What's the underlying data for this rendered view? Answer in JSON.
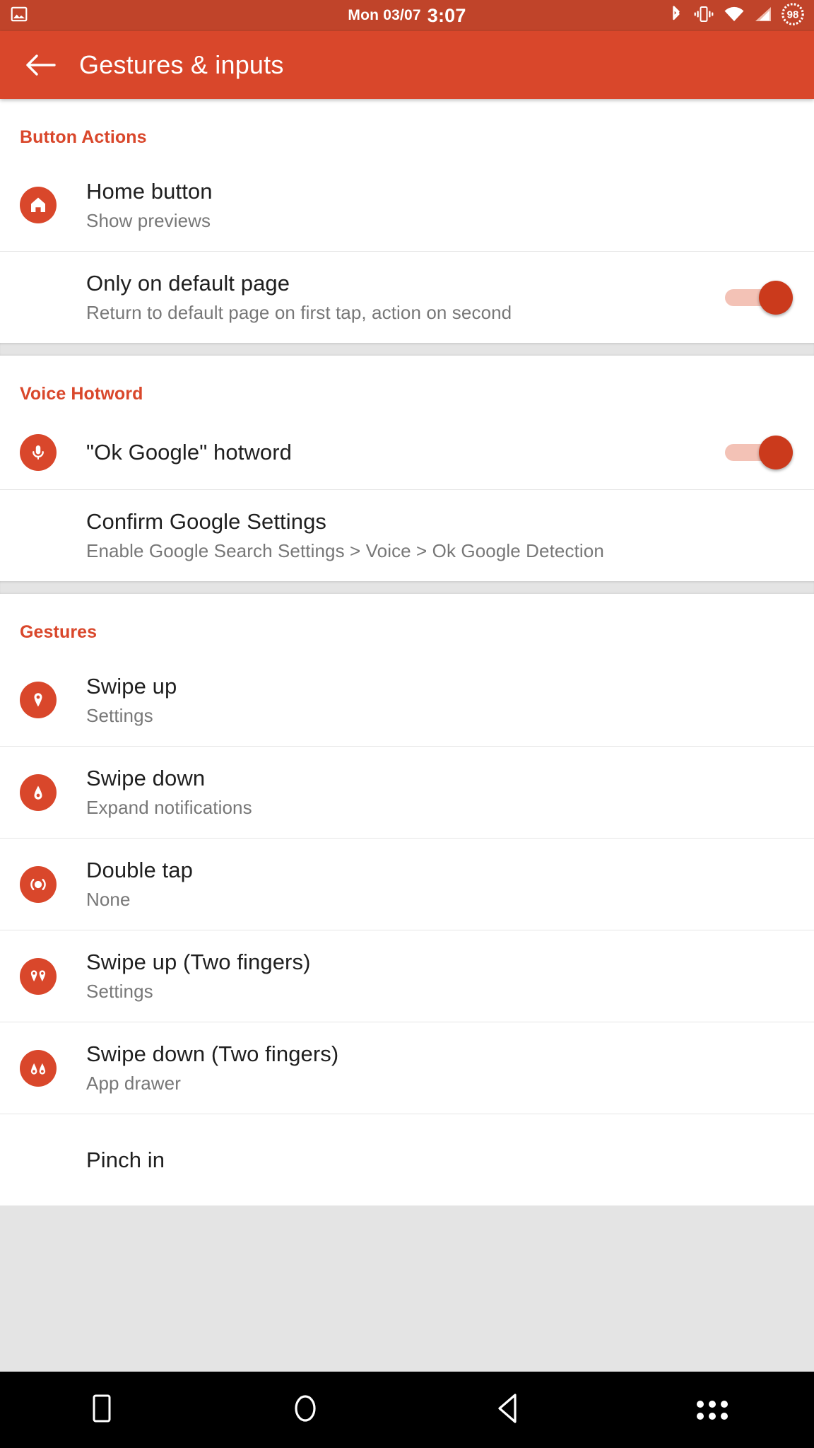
{
  "status_bar": {
    "date": "Mon 03/07",
    "time": "3:07",
    "battery_level": "98",
    "icons_left": [
      "image-icon"
    ],
    "icons_right": [
      "bluetooth-icon",
      "vibrate-icon",
      "wifi-icon",
      "cellular-signal-icon",
      "battery-icon"
    ]
  },
  "app_bar": {
    "back_icon": "back-arrow-icon",
    "title": "Gestures & inputs"
  },
  "colors": {
    "accent": "#d9472b",
    "status_bar": "#c0442a",
    "toggle_track": "#f3c2b6",
    "toggle_thumb": "#cb3a1c",
    "title_text": "#1f1f1f",
    "sub_text": "#777777"
  },
  "sections": [
    {
      "title": "Button Actions",
      "rows": [
        {
          "icon": "home-icon",
          "title": "Home button",
          "subtitle": "Show previews",
          "control": "none"
        },
        {
          "icon": "none",
          "title": "Only on default page",
          "subtitle": "Return to default page on first tap, action on second",
          "control": "toggle",
          "toggle_state": "on"
        }
      ]
    },
    {
      "title": "Voice Hotword",
      "rows": [
        {
          "icon": "microphone-icon",
          "title": "\"Ok Google\" hotword",
          "subtitle": "",
          "control": "toggle",
          "toggle_state": "on"
        },
        {
          "icon": "none",
          "title": "Confirm Google Settings",
          "subtitle": "Enable Google Search Settings > Voice > Ok Google Detection",
          "control": "none"
        }
      ]
    },
    {
      "title": "Gestures",
      "rows": [
        {
          "icon": "pin-up-icon",
          "title": "Swipe up",
          "subtitle": "Settings",
          "control": "none"
        },
        {
          "icon": "pin-down-icon",
          "title": "Swipe down",
          "subtitle": "Expand notifications",
          "control": "none"
        },
        {
          "icon": "double-tap-icon",
          "title": "Double tap",
          "subtitle": "None",
          "control": "none"
        },
        {
          "icon": "two-pins-up-icon",
          "title": "Swipe up (Two fingers)",
          "subtitle": "Settings",
          "control": "none"
        },
        {
          "icon": "two-pins-down-icon",
          "title": "Swipe down (Two fingers)",
          "subtitle": "App drawer",
          "control": "none"
        },
        {
          "icon": "pinch-icon",
          "title": "Pinch in",
          "subtitle": "",
          "control": "none",
          "cut_off": true
        }
      ]
    }
  ],
  "nav_bar": {
    "buttons": [
      {
        "name": "overview-button",
        "icon": "square-icon"
      },
      {
        "name": "home-button",
        "icon": "circle-icon"
      },
      {
        "name": "back-button",
        "icon": "triangle-left-icon"
      },
      {
        "name": "menu-button",
        "icon": "six-dot-grid-icon"
      }
    ]
  }
}
